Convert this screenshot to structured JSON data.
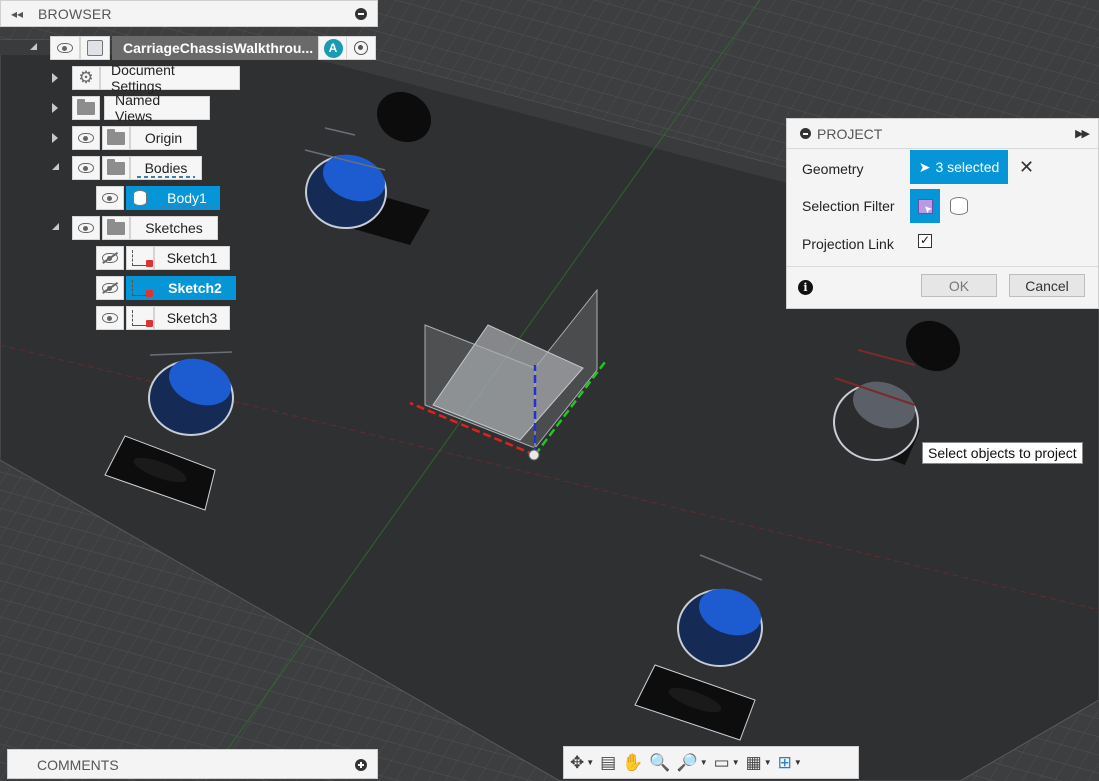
{
  "browser": {
    "title": "BROWSER",
    "root": {
      "label": "CarriageChassisWalkthrou...",
      "badge": "A"
    },
    "items": [
      {
        "label": "Document Settings"
      },
      {
        "label": "Named Views"
      },
      {
        "label": "Origin"
      },
      {
        "label": "Bodies"
      },
      {
        "label": "Body1"
      },
      {
        "label": "Sketches"
      },
      {
        "label": "Sketch1"
      },
      {
        "label": "Sketch2"
      },
      {
        "label": "Sketch3"
      }
    ]
  },
  "project": {
    "title": "PROJECT",
    "geometry_label": "Geometry",
    "geometry_value": "3 selected",
    "filter_label": "Selection Filter",
    "link_label": "Projection Link",
    "link_checked": "✓",
    "ok": "OK",
    "cancel": "Cancel"
  },
  "tooltip": "Select objects to project",
  "comments": {
    "title": "COMMENTS"
  },
  "colors": {
    "accent": "#0696d7",
    "hole_blue": "#1d5bd0",
    "axis_red": "#e02020",
    "axis_green": "#22c722",
    "axis_blue": "#2233cc"
  }
}
